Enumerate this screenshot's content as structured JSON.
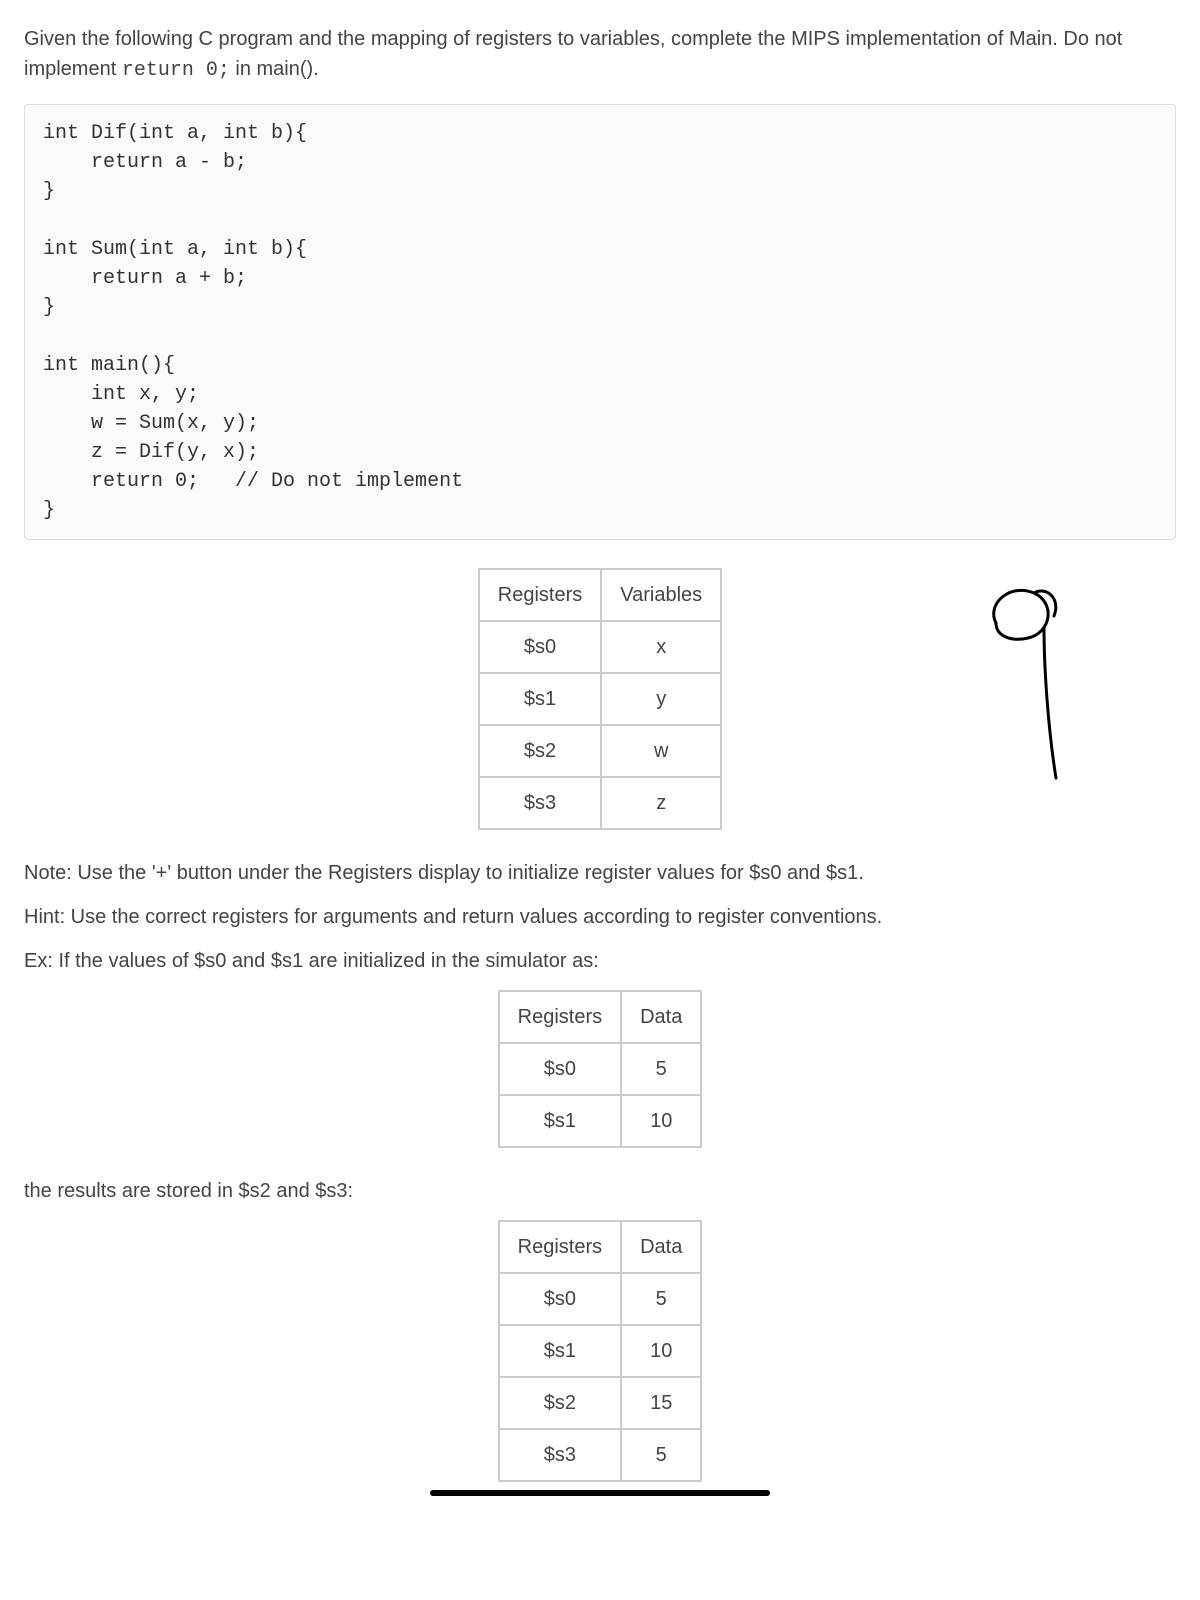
{
  "intro": {
    "part1": "Given the following C program and the mapping of registers to variables, complete the MIPS implementation of Main. Do not implement ",
    "code": "return 0;",
    "part2": " in main()."
  },
  "code_block": "int Dif(int a, int b){\n    return a - b;\n}\n\nint Sum(int a, int b){\n    return a + b;\n}\n\nint main(){\n    int x, y;\n    w = Sum(x, y);\n    z = Dif(y, x);\n    return 0;   // Do not implement\n}",
  "table1": {
    "headers": [
      "Registers",
      "Variables"
    ],
    "rows": [
      [
        "$s0",
        "x"
      ],
      [
        "$s1",
        "y"
      ],
      [
        "$s2",
        "w"
      ],
      [
        "$s3",
        "z"
      ]
    ]
  },
  "notes": {
    "line1": "Note: Use the '+' button under the Registers display to initialize register values for $s0 and $s1.",
    "line2": "Hint: Use the correct registers for arguments and return values according to register conventions.",
    "line3": "Ex: If the values of $s0 and $s1 are initialized in the simulator as:"
  },
  "table2": {
    "headers": [
      "Registers",
      "Data"
    ],
    "rows": [
      [
        "$s0",
        "5"
      ],
      [
        "$s1",
        "10"
      ]
    ]
  },
  "results_label": "the results are stored in $s2 and $s3:",
  "table3": {
    "headers": [
      "Registers",
      "Data"
    ],
    "rows": [
      [
        "$s0",
        "5"
      ],
      [
        "$s1",
        "10"
      ],
      [
        "$s2",
        "15"
      ],
      [
        "$s3",
        "5"
      ]
    ]
  }
}
